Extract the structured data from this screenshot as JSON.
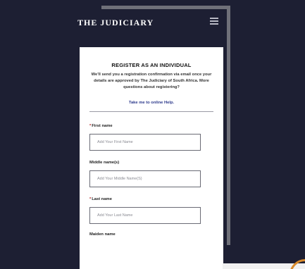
{
  "header": {
    "site_title": "THE JUDICIARY",
    "menu_icon": "hamburger-menu-icon"
  },
  "card": {
    "title": "REGISTER AS AN INDIVIDUAL",
    "intro": "We'll send you a registration confirmation via email once your details are approved by The Judiciary of South Africa. More questions about registering?",
    "help_link": "Take me to online Help."
  },
  "form": {
    "first_name": {
      "label": "First name",
      "required": true,
      "placeholder": "Add Your First Name",
      "value": ""
    },
    "middle_name": {
      "label": "Middle name(s)",
      "required": false,
      "placeholder": "Add Your Middle Name(S)",
      "value": ""
    },
    "last_name": {
      "label": "Last name",
      "required": true,
      "placeholder": "Add Your Last Name",
      "value": ""
    },
    "maiden_name": {
      "label": "Maiden name",
      "required": false
    },
    "required_marker": "*"
  },
  "colors": {
    "background": "#1d1f33",
    "card": "#ffffff",
    "link": "#2d3a8c",
    "frame": "#6f7079",
    "accent": "#d98a2b"
  }
}
